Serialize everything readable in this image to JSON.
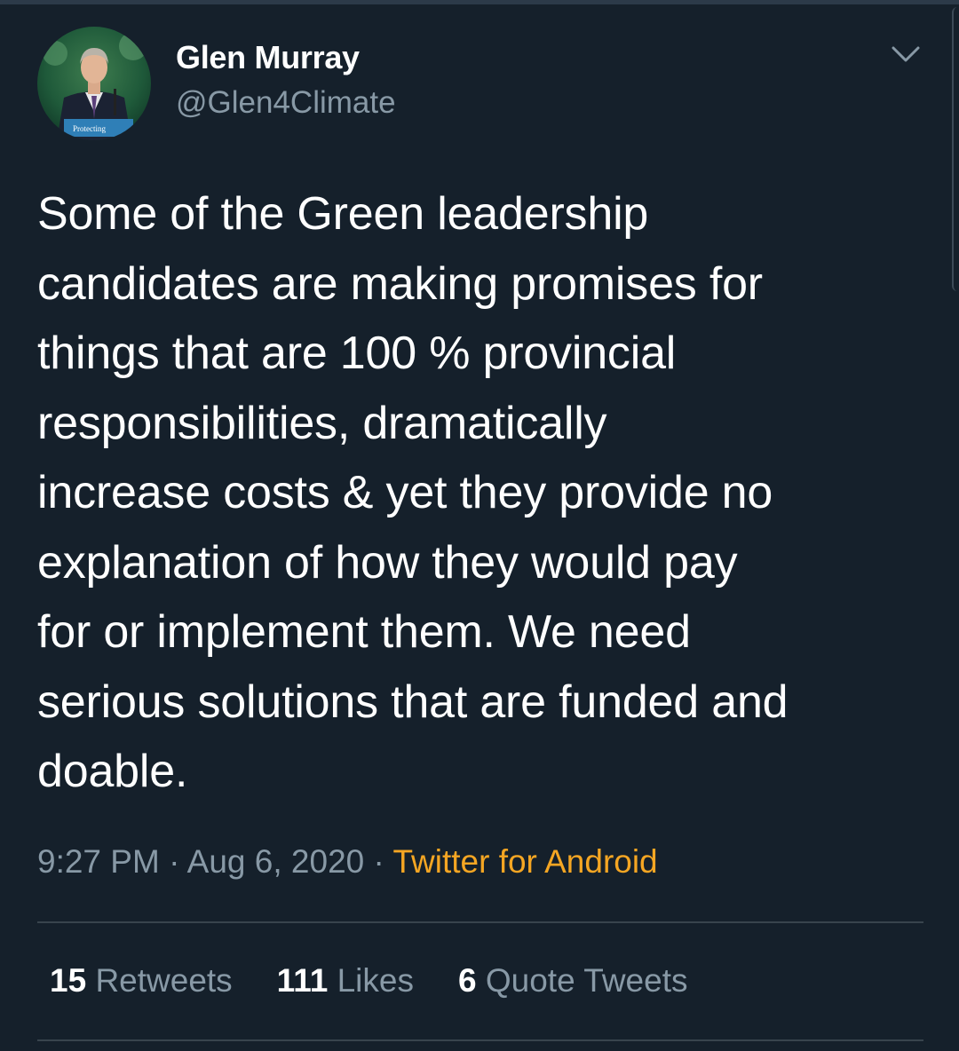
{
  "author": {
    "display_name": "Glen Murray",
    "handle": "@Glen4Climate",
    "avatar_icon": "profile-photo-speaker-at-podium",
    "avatar_banner_text": "Protecting"
  },
  "tweet": {
    "text": "Some of the Green leadership\ncandidates are making promises for\nthings that are 100 % provincial\nresponsibilities, dramatically\nincrease costs & yet they provide no\nexplanation of how they would pay\nfor or implement them. We need\nserious solutions that are funded and\ndoable.",
    "time": "9:27 PM",
    "separator": "·",
    "date": "Aug 6, 2020",
    "source": "Twitter for Android"
  },
  "stats": {
    "retweets_count": "15",
    "retweets_label": "Retweets",
    "likes_count": "111",
    "likes_label": "Likes",
    "quotes_count": "6",
    "quotes_label": "Quote Tweets"
  },
  "colors": {
    "background": "#15202b",
    "secondary_text": "#8899a6",
    "source_link": "#f5a623",
    "divider": "#38444d"
  },
  "icons": {
    "menu": "chevron-down-icon"
  }
}
